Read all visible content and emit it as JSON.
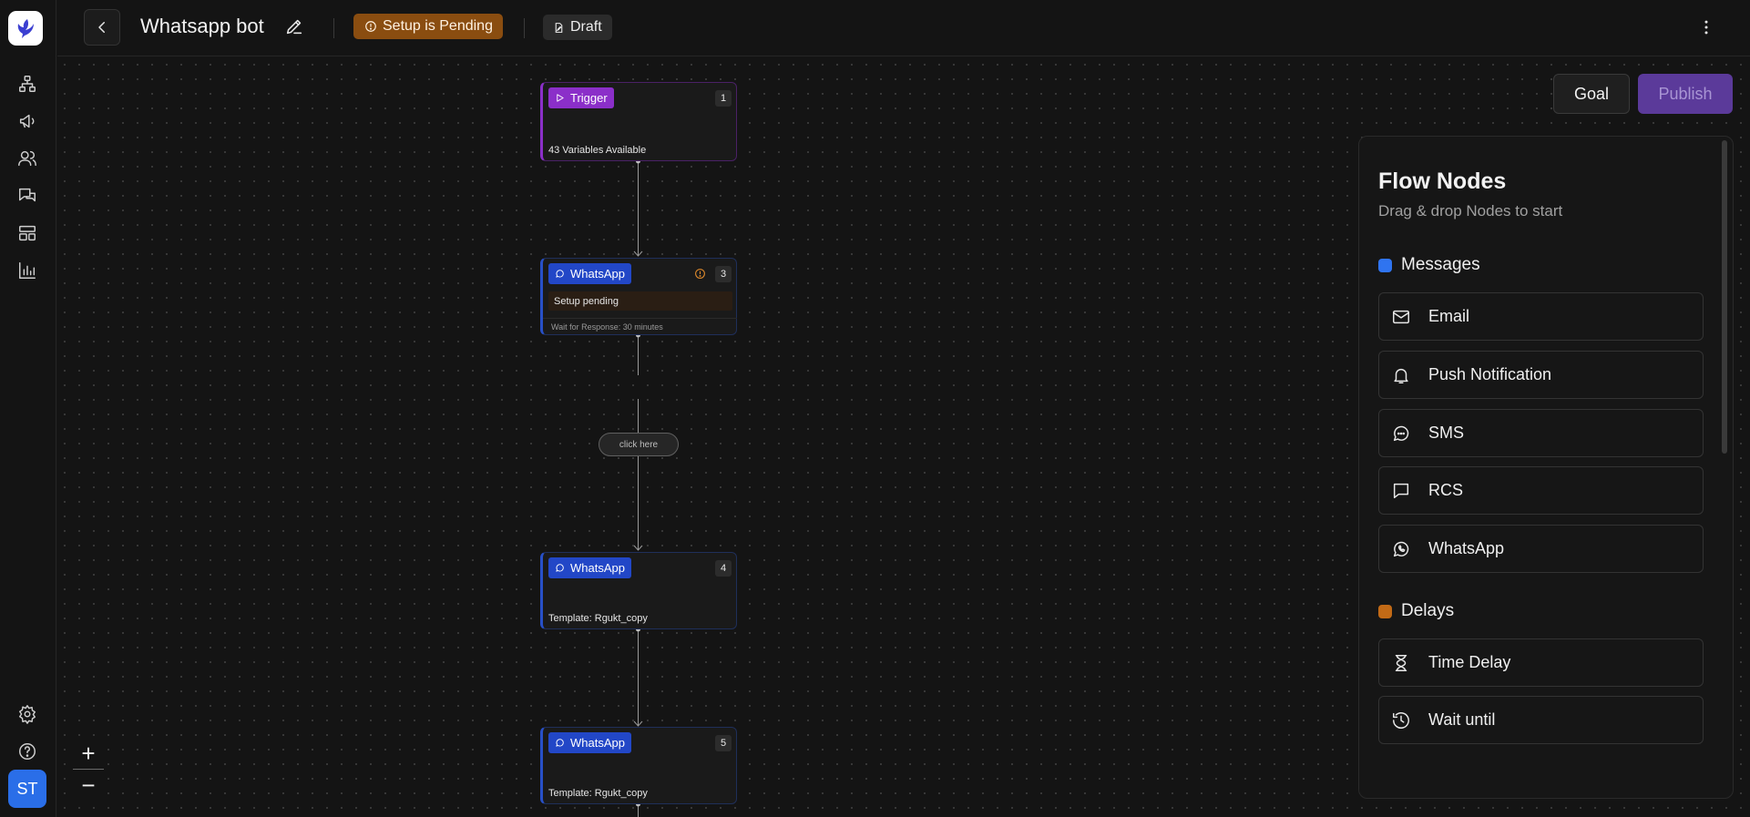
{
  "header": {
    "title": "Whatsapp bot",
    "setup_badge": "Setup is Pending",
    "draft_badge": "Draft"
  },
  "sidebar": {
    "avatar_initials": "ST",
    "nav_icons": [
      "flows-icon",
      "campaigns-icon",
      "users-icon",
      "chats-icon",
      "templates-icon",
      "analytics-icon",
      "settings-icon",
      "help-icon"
    ]
  },
  "toolbar": {
    "goal_label": "Goal",
    "publish_label": "Publish"
  },
  "canvas": {
    "nodes": [
      {
        "tag": "Trigger",
        "number": "1",
        "footer": "43 Variables Available"
      },
      {
        "tag": "WhatsApp",
        "number": "3",
        "pending": "Setup pending",
        "wait": "Wait for Response: 30 minutes"
      },
      {
        "tag": "WhatsApp",
        "number": "4",
        "footer": "Template: Rgukt_copy"
      },
      {
        "tag": "WhatsApp",
        "number": "5",
        "footer": "Template: Rgukt_copy"
      }
    ],
    "edge_label": "click here",
    "zoom_in": "+",
    "zoom_out": "−"
  },
  "panel": {
    "title": "Flow Nodes",
    "subtitle": "Drag & drop Nodes to start",
    "sections": [
      {
        "label": "Messages",
        "color": "#2f74f0",
        "items": [
          "Email",
          "Push Notification",
          "SMS",
          "RCS",
          "WhatsApp"
        ]
      },
      {
        "label": "Delays",
        "color": "#c26a16",
        "items": [
          "Time Delay",
          "Wait until"
        ]
      }
    ]
  },
  "colors": {
    "trigger": "#8b2fc9",
    "whatsapp": "#2247c7",
    "setup_badge": "#8a4d10",
    "publish": "#5b3a9a",
    "avatar": "#2a6ee8"
  }
}
